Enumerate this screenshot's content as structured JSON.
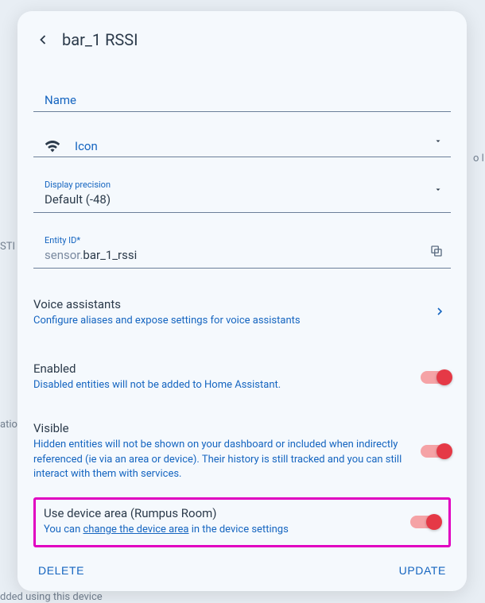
{
  "header": {
    "title": "bar_1 RSSI"
  },
  "fields": {
    "name": {
      "label": "Name",
      "value": ""
    },
    "icon": {
      "label": "Icon",
      "glyph": "wifi-icon"
    },
    "precision": {
      "label": "Display precision",
      "value": "Default (-48)"
    },
    "entity": {
      "label": "Entity ID*",
      "prefix": "sensor.",
      "value": "bar_1_rssi"
    }
  },
  "voice": {
    "title": "Voice assistants",
    "desc": "Configure aliases and expose settings for voice assistants"
  },
  "enabled": {
    "title": "Enabled",
    "desc": "Disabled entities will not be added to Home Assistant.",
    "on": true
  },
  "visible": {
    "title": "Visible",
    "desc": "Hidden entities will not be shown on your dashboard or included when indirectly referenced (ie via an area or device). Their history is still tracked and you can still interact with them with services.",
    "on": true
  },
  "device_area": {
    "title": "Use device area (Rumpus Room)",
    "desc_pre": "You can ",
    "desc_link": "change the device area",
    "desc_post": " in the device settings",
    "on": true
  },
  "footer": {
    "delete": "DELETE",
    "update": "UPDATE"
  },
  "bg": {
    "t1": "atio",
    "t2": "dded using this device",
    "t3": "o l",
    "t4": "STI"
  }
}
